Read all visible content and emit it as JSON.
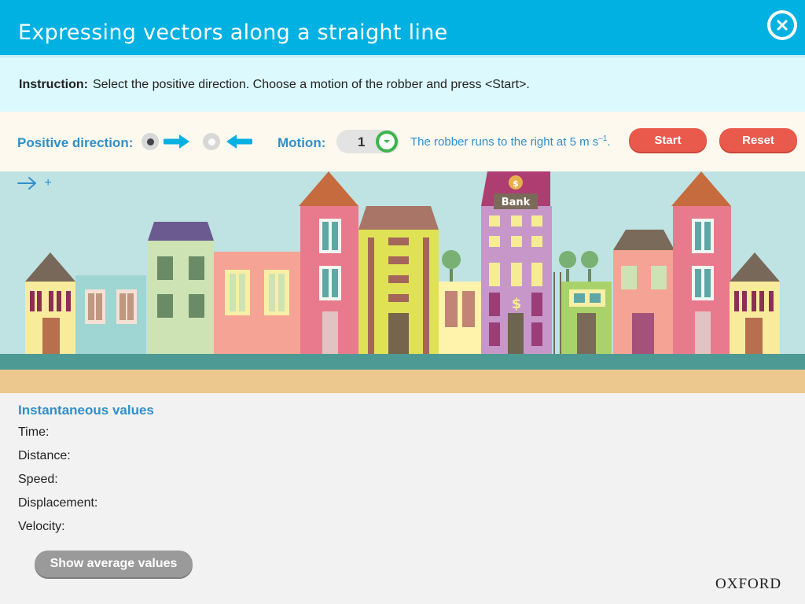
{
  "header": {
    "title": "Expressing vectors along a straight line"
  },
  "instruction": {
    "label": "Instruction:",
    "text": "Select the positive direction. Choose a motion of the robber and press <Start>."
  },
  "controls": {
    "positive_direction_label": "Positive direction:",
    "motion_label": "Motion:",
    "motion_value": "1",
    "motion_description": "The robber runs to the right at 5 m s",
    "motion_description_sup": "–1",
    "motion_description_end": ".",
    "start_label": "Start",
    "reset_label": "Reset"
  },
  "scene": {
    "direction_indicator": "+",
    "bank_label": "Bank",
    "dollar": "$"
  },
  "values": {
    "heading": "Instantaneous values",
    "rows": [
      "Time:",
      "Distance:",
      "Speed:",
      "Displacement:",
      "Velocity:"
    ],
    "average_button": "Show average values"
  },
  "brand": "OXFORD",
  "colors": {
    "accent": "#01b1e2",
    "button_red": "#e95a4c",
    "label_blue": "#2f8fca"
  }
}
